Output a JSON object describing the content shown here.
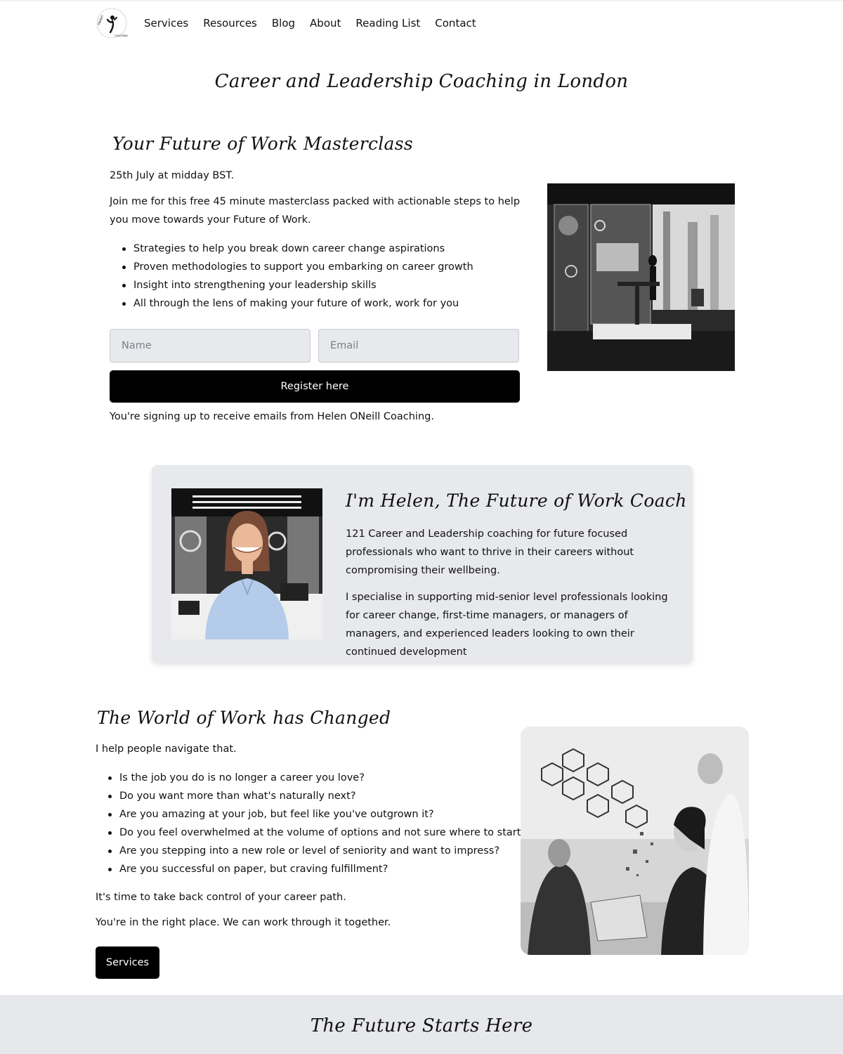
{
  "header": {
    "logo_text": "Helen ONeill Coaching",
    "nav": [
      "Services",
      "Resources",
      "Blog",
      "About",
      "Reading List",
      "Contact"
    ]
  },
  "hero": {
    "title": "Career and Leadership Coaching in London"
  },
  "masterclass": {
    "title": "Your Future of Work Masterclass",
    "date": "25th July at midday BST.",
    "intro": "Join me for this free 45 minute masterclass packed with actionable steps to help you move towards your Future of Work.",
    "bullets": [
      "Strategies to help you break down career change aspirations",
      "Proven methodologies to support you embarking on career growth",
      "Insight into strengthening your leadership skills",
      "All through the lens of making your future of work, work for you"
    ],
    "name_placeholder": "Name",
    "email_placeholder": "Email",
    "register_label": "Register here",
    "note": "You're signing up to receive emails from Helen ONeill Coaching."
  },
  "about": {
    "title": "I'm Helen, The Future of Work Coach",
    "p1": "121 Career and Leadership coaching for future focused professionals who want to thrive in their careers without compromising their wellbeing.",
    "p2": "I specialise in supporting mid-senior level professionals looking for career change, first-time managers, or managers of managers, and experienced leaders looking to own their continued development"
  },
  "world": {
    "title": "The World of Work has Changed",
    "intro": "I help people navigate that.",
    "bullets": [
      "Is the job you do is no longer a career you love?",
      "Do you want more than what's naturally next?",
      "Are you amazing at your job, but feel like you've outgrown it?",
      "Do you feel overwhelmed at the volume of options and not sure where to start?",
      "Are you stepping into a new role or level of seniority and want to impress?",
      "Are you successful on paper, but craving fulfillment?"
    ],
    "p1": "It's time to take back control of your career path.",
    "p2": "You're in the right place. We can work through it together.",
    "services_label": "Services"
  },
  "future": {
    "title": "The Future Starts Here"
  },
  "colors": {
    "button": "#000000",
    "card_bg": "#e8e9ec",
    "band_bg": "#e7e8eb",
    "input_bg": "#e7e9ec"
  }
}
